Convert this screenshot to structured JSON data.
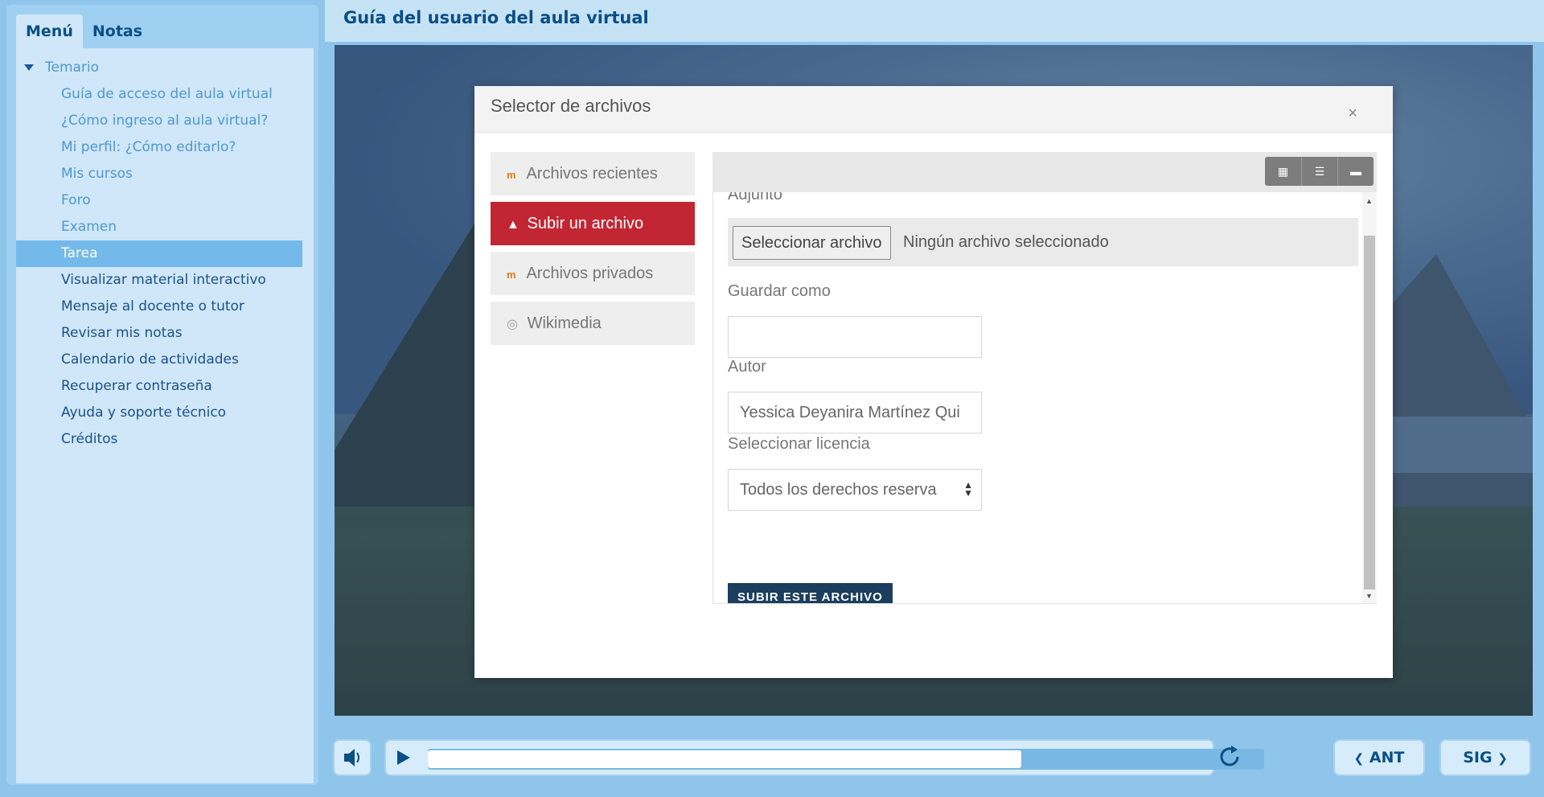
{
  "course_title": "Guía del usuario del aula virtual",
  "sidebar": {
    "tabs": [
      {
        "label": "Menú",
        "active": true
      },
      {
        "label": "Notas",
        "active": false
      }
    ],
    "chapter": "Temario",
    "items": [
      {
        "label": "Guía de acceso del aula virtual",
        "state": "visited"
      },
      {
        "label": "¿Cómo ingreso al aula virtual?",
        "state": "visited"
      },
      {
        "label": "Mi perfil: ¿Cómo editarlo?",
        "state": "visited"
      },
      {
        "label": "Mis cursos",
        "state": "visited"
      },
      {
        "label": "Foro",
        "state": "visited"
      },
      {
        "label": "Examen",
        "state": "visited"
      },
      {
        "label": "Tarea",
        "state": "current"
      },
      {
        "label": "Visualizar material interactivo",
        "state": "pending"
      },
      {
        "label": "Mensaje al docente o tutor",
        "state": "pending"
      },
      {
        "label": "Revisar mis notas",
        "state": "pending"
      },
      {
        "label": "Calendario de actividades",
        "state": "pending"
      },
      {
        "label": "Recuperar contraseña",
        "state": "pending"
      },
      {
        "label": "Ayuda y soporte técnico",
        "state": "pending"
      },
      {
        "label": "Créditos",
        "state": "pending"
      }
    ]
  },
  "file_picker": {
    "title": "Selector de archivos",
    "close": "×",
    "repositories": [
      {
        "label": "Archivos recientes",
        "icon": "moodle-icon",
        "active": false
      },
      {
        "label": "Subir un archivo",
        "icon": "upload-icon",
        "active": true
      },
      {
        "label": "Archivos privados",
        "icon": "moodle-icon",
        "active": false
      },
      {
        "label": "Wikimedia",
        "icon": "wikimedia-icon",
        "active": false
      }
    ],
    "view_buttons": [
      "icons-view",
      "list-view",
      "tree-view"
    ],
    "attachment_label": "Adjunto",
    "choose_file_button": "Seleccionar archivo",
    "no_file_text": "Ningún archivo seleccionado",
    "save_as_label": "Guardar como",
    "save_as_value": "",
    "author_label": "Autor",
    "author_value": "Yessica Deyanira Martínez Qui",
    "license_label": "Seleccionar licencia",
    "license_value": "Todos los derechos reserva",
    "submit_button": "SUBIR ESTE ARCHIVO"
  },
  "player": {
    "progress": 0.71,
    "prev_label": "ANT",
    "next_label": "SIG"
  },
  "colors": {
    "accent": "#0a4f86",
    "active_repo": "#c32633",
    "submit": "#1b3e5e"
  }
}
